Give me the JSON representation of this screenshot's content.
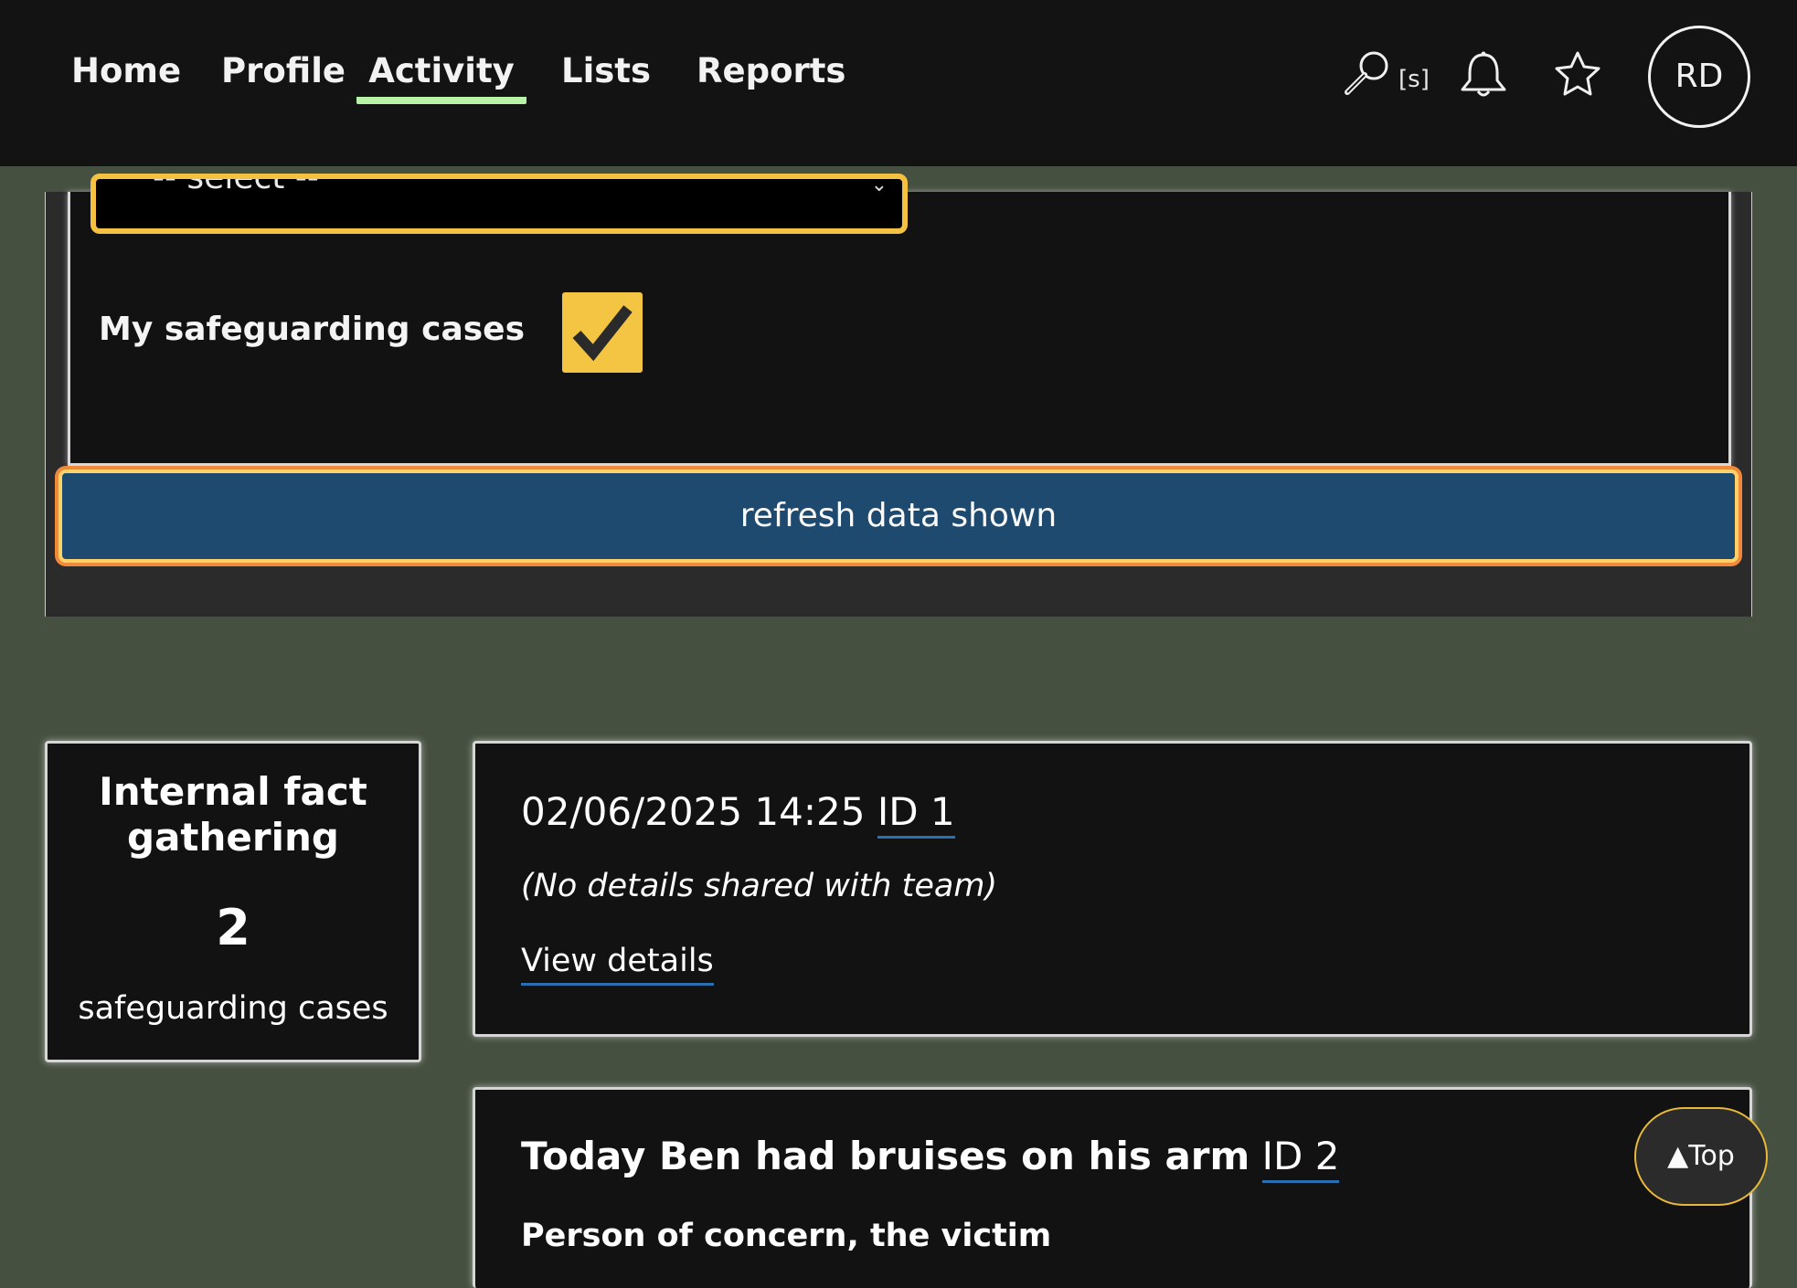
{
  "nav": {
    "items": [
      {
        "label": "Home"
      },
      {
        "label": "Profile"
      },
      {
        "label": "Activity",
        "active": true
      },
      {
        "label": "Lists"
      },
      {
        "label": "Reports"
      }
    ],
    "search_shortcut": "[s]",
    "avatar_initials": "RD"
  },
  "filters": {
    "select_placeholder": "-- select --",
    "my_cases_label": "My safeguarding cases",
    "my_cases_checked": true,
    "refresh_label": "refresh data shown"
  },
  "summary": {
    "title_line1": "Internal fact",
    "title_line2": "gathering",
    "count": "2",
    "unit": "safeguarding cases"
  },
  "activities": [
    {
      "date": "02/06/2025 14:25",
      "id_label": "ID 1",
      "details": "(No details shared with team)",
      "link": "View details"
    },
    {
      "title": "Today Ben had bruises on his arm",
      "id_label": "ID 2",
      "subtitle": "Person of concern, the victim"
    }
  ],
  "back_to_top": "▲Top",
  "colors": {
    "page_bg": "#455040",
    "header_bg": "#131313",
    "active_underline": "#b8f2a6",
    "checkbox": "#f4c542",
    "button_bg": "#1f4a6f",
    "focus_ring": "#f08a3a"
  }
}
